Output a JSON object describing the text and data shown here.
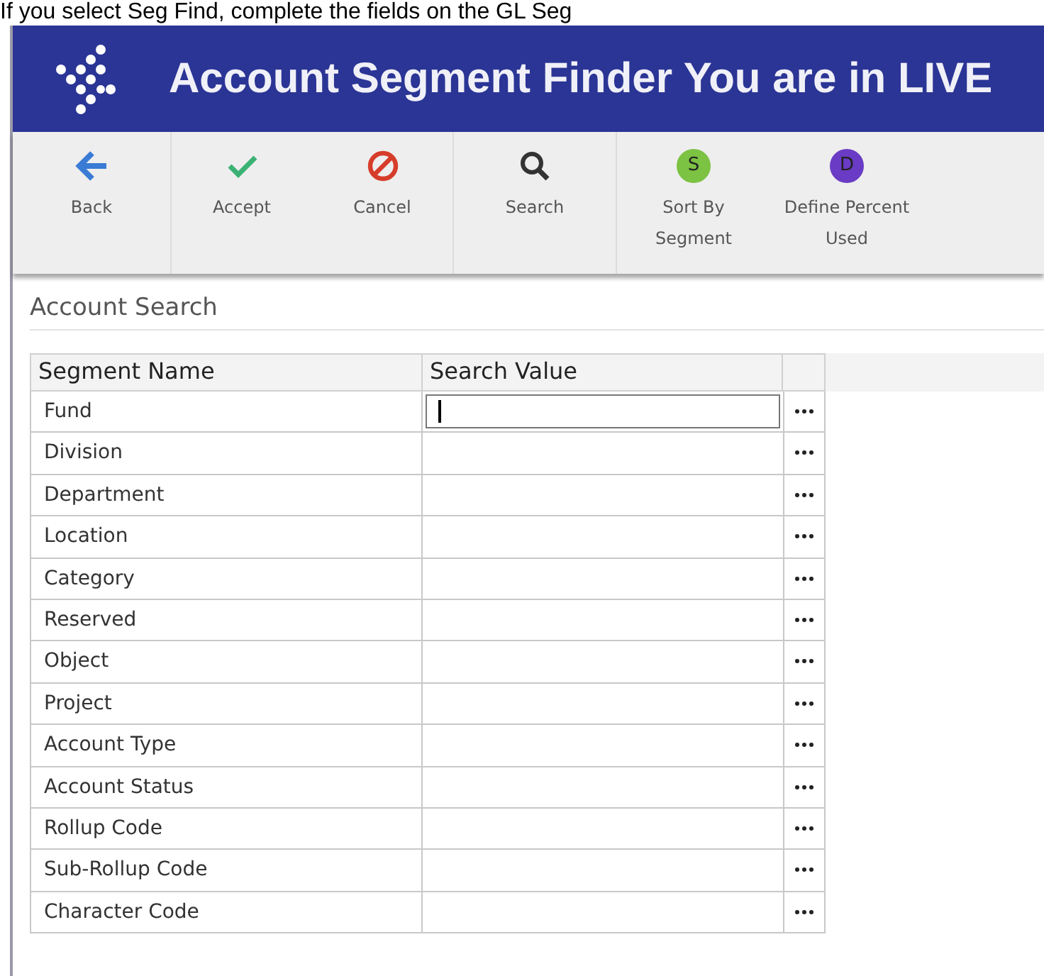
{
  "caption": "If you select Seg Find, complete the fields on the GL Seg",
  "window": {
    "title": "Account Segment Finder You are in LIVE"
  },
  "toolbar": [
    [
      {
        "kind": "back",
        "label": "Back"
      }
    ],
    [
      {
        "kind": "accept",
        "label": "Accept"
      },
      {
        "kind": "cancel",
        "label": "Cancel"
      }
    ],
    [
      {
        "kind": "search",
        "label": "Search"
      }
    ],
    [
      {
        "kind": "badge",
        "badge": "S",
        "color": "#7cc243",
        "label": "Sort By Segment"
      },
      {
        "kind": "badge",
        "badge": "D",
        "color": "#6a3bc4",
        "label": "Define Percent Used"
      }
    ]
  ],
  "section": {
    "title": "Account Search"
  },
  "table": {
    "columns": [
      "Segment Name",
      "Search Value"
    ],
    "rows": [
      {
        "name": "Fund",
        "focused": true
      },
      {
        "name": "Division",
        "focused": false
      },
      {
        "name": "Department",
        "focused": false
      },
      {
        "name": "Location",
        "focused": false
      },
      {
        "name": "Category",
        "focused": false
      },
      {
        "name": "Reserved",
        "focused": false
      },
      {
        "name": "Object",
        "focused": false
      },
      {
        "name": "Project",
        "focused": false
      },
      {
        "name": "Account Type",
        "focused": false
      },
      {
        "name": "Account Status",
        "focused": false
      },
      {
        "name": "Rollup Code",
        "focused": false
      },
      {
        "name": "Sub-Rollup Code",
        "focused": false
      },
      {
        "name": "Character Code",
        "focused": false
      }
    ]
  }
}
